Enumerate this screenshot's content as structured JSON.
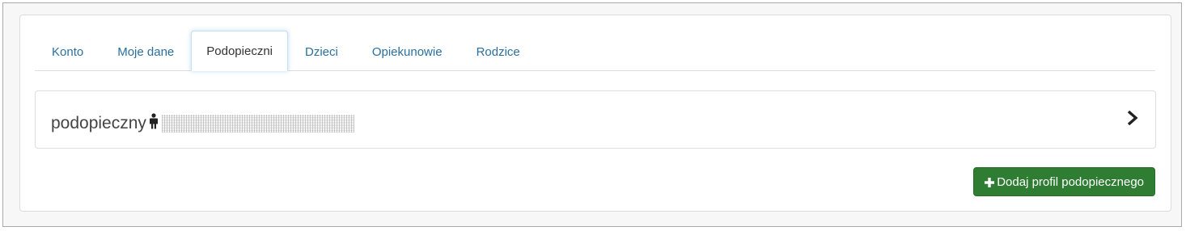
{
  "tabs": [
    {
      "label": "Konto",
      "active": false
    },
    {
      "label": "Moje dane",
      "active": false
    },
    {
      "label": "Podopieczni",
      "active": true
    },
    {
      "label": "Dzieci",
      "active": false
    },
    {
      "label": "Opiekunowie",
      "active": false
    },
    {
      "label": "Rodzice",
      "active": false
    }
  ],
  "profile": {
    "title": "podopieczny",
    "icon": "person-icon",
    "expand_icon": "chevron-right-icon"
  },
  "actions": {
    "add_profile_label": "Dodaj profil podopiecznego",
    "add_icon": "plus-icon",
    "button_color": "#2e7d32"
  }
}
